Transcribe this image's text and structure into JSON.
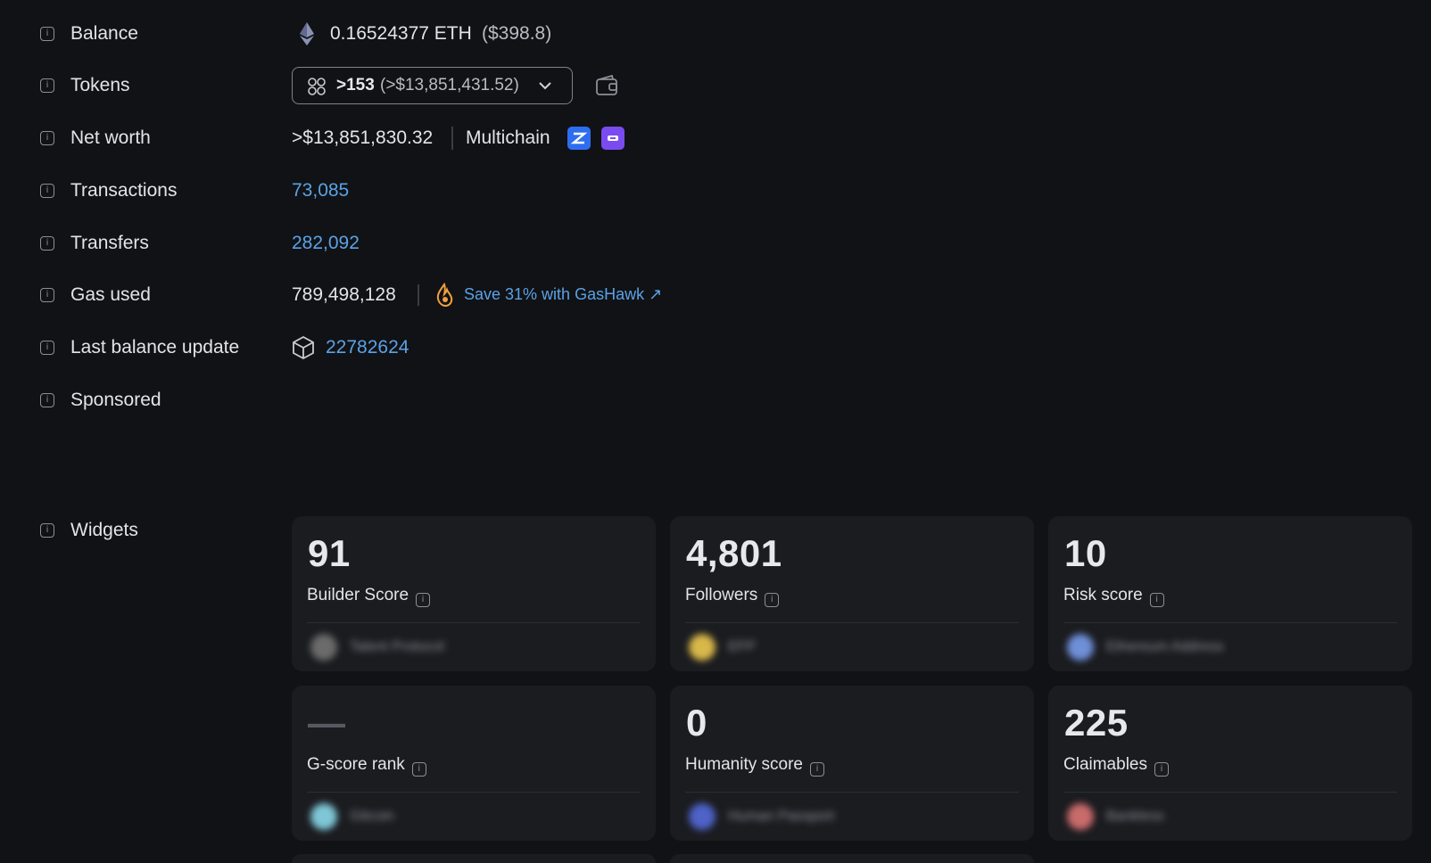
{
  "rows": {
    "balance": {
      "label": "Balance",
      "eth": "0.16524377 ETH",
      "usd": "($398.8)"
    },
    "tokens": {
      "label": "Tokens",
      "count": ">153",
      "value": "(>$13,851,431.52)"
    },
    "net_worth": {
      "label": "Net worth",
      "value": ">$13,851,830.32",
      "multichain": "Multichain"
    },
    "transactions": {
      "label": "Transactions",
      "value": "73,085"
    },
    "transfers": {
      "label": "Transfers",
      "value": "282,092"
    },
    "gas_used": {
      "label": "Gas used",
      "value": "789,498,128",
      "promo": "Save 31% with GasHawk ↗"
    },
    "last_balance_update": {
      "label": "Last balance update",
      "block": "22782624"
    },
    "sponsored": {
      "label": "Sponsored"
    },
    "widgets": {
      "label": "Widgets"
    }
  },
  "widgets": [
    {
      "value": "91",
      "name": "Builder Score",
      "provider": "Talent Protocol",
      "avatar_color": "#6b6b6b"
    },
    {
      "value": "4,801",
      "name": "Followers",
      "provider": "EFP",
      "avatar_color": "#d9b84a"
    },
    {
      "value": "10",
      "name": "Risk score",
      "provider": "Ethereum Address",
      "avatar_color": "#6f8fd8"
    },
    {
      "value": "—",
      "name": "G-score rank",
      "provider": "Gitcoin",
      "avatar_color": "#7fc6d6"
    },
    {
      "value": "0",
      "name": "Humanity score",
      "provider": "Human Passport",
      "avatar_color": "#4e62c8"
    },
    {
      "value": "225",
      "name": "Claimables",
      "provider": "Bankless",
      "avatar_color": "#c86b6b"
    }
  ],
  "colors": {
    "background": "#111215",
    "link": "#5aa2e6",
    "card": "#1b1c20",
    "multichain_badge_1": "#2f6df0",
    "multichain_badge_2": "#7a4cf0",
    "gashawk": "#f0a040"
  }
}
